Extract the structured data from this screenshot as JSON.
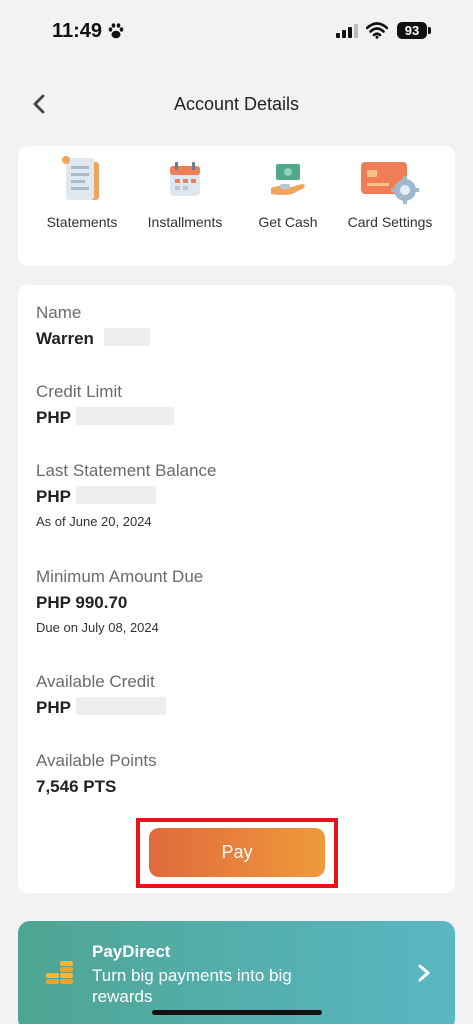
{
  "status_bar": {
    "time": "11:49",
    "battery": "93"
  },
  "header": {
    "title": "Account Details"
  },
  "quick_actions": [
    {
      "label": "Statements",
      "icon": "statement-scroll-icon"
    },
    {
      "label": "Installments",
      "icon": "calendar-icon"
    },
    {
      "label": "Get Cash",
      "icon": "cash-hand-icon"
    },
    {
      "label": "Card Settings",
      "icon": "card-gear-icon"
    }
  ],
  "details": {
    "name_label": "Name",
    "name_value": "Warren",
    "credit_limit_label": "Credit Limit",
    "credit_limit_currency": "PHP",
    "last_statement_label": "Last Statement Balance",
    "last_statement_currency": "PHP",
    "last_statement_date": "As of June 20, 2024",
    "min_due_label": "Minimum Amount Due",
    "min_due_value": "PHP 990.70",
    "min_due_date": "Due on July 08, 2024",
    "available_credit_label": "Available Credit",
    "available_credit_currency": "PHP",
    "available_points_label": "Available Points",
    "available_points_value": "7,546 PTS"
  },
  "pay_button": {
    "label": "Pay"
  },
  "paydirect": {
    "title": "PayDirect",
    "description": "Turn big payments into big rewards"
  },
  "colors": {
    "accent_orange": "#e8843a",
    "highlight_red": "#e8121b",
    "banner_teal": "#4ea593"
  }
}
